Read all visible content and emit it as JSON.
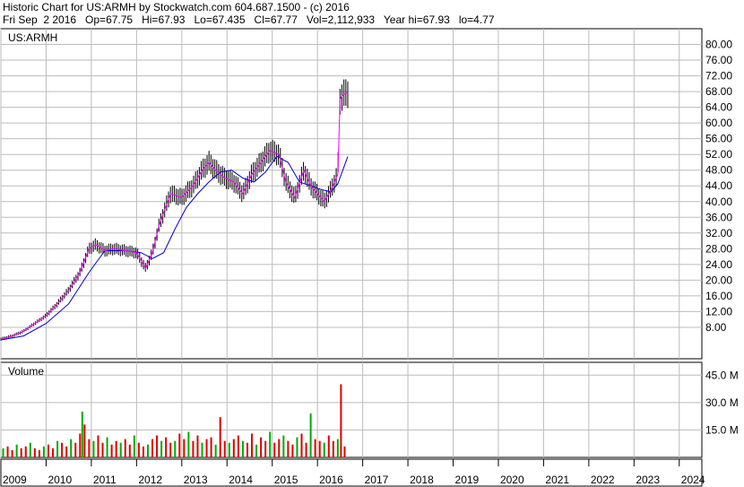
{
  "header": {
    "line1": "Historic Chart for US:ARMH by Stockwatch.com 604.687.1500 - (c) 2016",
    "line2": "Fri Sep  2 2016   Op=67.75   Hi=67.93   Lo=67.435   Cl=67.77   Vol=2,112,933   Year hi=67.93   lo=4.77"
  },
  "colors": {
    "price_line": "#ff00ff",
    "ma_line": "#0000cc",
    "candle": "#000000",
    "vol_up": "#00aa00",
    "vol_down": "#dd0000",
    "grid": "#bbbbbb"
  },
  "chart_data": [
    {
      "type": "line",
      "title": "US:ARMH",
      "ylim": [
        0,
        84
      ],
      "yticks": [
        "8.00",
        "12.00",
        "16.00",
        "20.00",
        "24.00",
        "28.00",
        "32.00",
        "36.00",
        "40.00",
        "44.00",
        "48.00",
        "52.00",
        "56.00",
        "60.00",
        "64.00",
        "68.00",
        "72.00",
        "76.00",
        "80.00"
      ],
      "xticks": [
        "2009",
        "2010",
        "2011",
        "2012",
        "2013",
        "2014",
        "2015",
        "2016",
        "2017",
        "2018",
        "2019",
        "2020",
        "2021",
        "2022",
        "2023",
        "2024"
      ],
      "series": [
        {
          "x": [
            2009.0,
            2009.25,
            2009.5,
            2009.75,
            2010.0,
            2010.25,
            2010.5,
            2010.75,
            2010.95,
            2011.1,
            2011.3,
            2011.5,
            2011.75,
            2012.0,
            2012.2,
            2012.35,
            2012.5,
            2012.75,
            2013.0,
            2013.25,
            2013.45,
            2013.6,
            2013.75,
            2013.95,
            2014.15,
            2014.35,
            2014.55,
            2014.75,
            2014.95,
            2015.15,
            2015.3,
            2015.5,
            2015.7,
            2015.85,
            2016.0,
            2016.15,
            2016.3,
            2016.45,
            2016.5,
            2016.55,
            2016.67
          ],
          "values": [
            5.0,
            5.8,
            7.0,
            9.0,
            11.0,
            14.0,
            17.5,
            22.0,
            28.0,
            29.0,
            27.5,
            28.0,
            27.5,
            27.0,
            23.0,
            27.0,
            34.0,
            42.0,
            41.0,
            44.0,
            48.0,
            50.0,
            48.0,
            46.0,
            45.0,
            42.0,
            47.0,
            50.0,
            53.0,
            52.0,
            45.0,
            41.0,
            48.0,
            44.0,
            42.0,
            40.0,
            43.0,
            47.0,
            66.0,
            67.0,
            67.77
          ]
        },
        {
          "x": [
            2009.0,
            2009.5,
            2010.0,
            2010.5,
            2010.95,
            2011.3,
            2011.75,
            2012.1,
            2012.35,
            2012.6,
            2012.85,
            2013.1,
            2013.35,
            2013.6,
            2013.85,
            2014.1,
            2014.35,
            2014.6,
            2014.85,
            2015.1,
            2015.35,
            2015.6,
            2015.85,
            2016.1,
            2016.3,
            2016.45,
            2016.67
          ],
          "values": [
            4.8,
            5.8,
            9.0,
            14.0,
            22.0,
            27.5,
            27.5,
            27.0,
            25.5,
            27.0,
            33.0,
            38.5,
            42.0,
            45.0,
            47.5,
            48.0,
            46.0,
            45.0,
            47.5,
            51.5,
            50.0,
            45.0,
            44.0,
            43.0,
            42.5,
            44.5,
            51.5
          ]
        }
      ]
    },
    {
      "type": "bar",
      "title": "Volume",
      "ylim": [
        0,
        52
      ],
      "yticks": [
        "15.0 M",
        "30.0 M",
        "45.0 M"
      ],
      "series": [
        {
          "x": [
            2009.05,
            2009.15,
            2009.25,
            2009.35,
            2009.45,
            2009.55,
            2009.65,
            2009.75,
            2009.85,
            2009.95,
            2010.05,
            2010.15,
            2010.25,
            2010.35,
            2010.45,
            2010.55,
            2010.65,
            2010.75,
            2010.8,
            2010.85,
            2010.95,
            2011.05,
            2011.15,
            2011.25,
            2011.35,
            2011.45,
            2011.55,
            2011.65,
            2011.75,
            2011.85,
            2011.95,
            2012.05,
            2012.15,
            2012.25,
            2012.35,
            2012.45,
            2012.55,
            2012.65,
            2012.75,
            2012.85,
            2012.95,
            2013.05,
            2013.15,
            2013.25,
            2013.35,
            2013.45,
            2013.55,
            2013.65,
            2013.75,
            2013.85,
            2013.95,
            2014.05,
            2014.15,
            2014.25,
            2014.35,
            2014.45,
            2014.55,
            2014.65,
            2014.75,
            2014.85,
            2014.95,
            2015.05,
            2015.15,
            2015.25,
            2015.35,
            2015.45,
            2015.55,
            2015.65,
            2015.75,
            2015.85,
            2015.95,
            2016.05,
            2016.15,
            2016.25,
            2016.35,
            2016.45,
            2016.52,
            2016.6
          ],
          "values": [
            5,
            6,
            4,
            7,
            5,
            6,
            8,
            5,
            4,
            6,
            7,
            5,
            9,
            8,
            6,
            10,
            8,
            13,
            25,
            18,
            10,
            9,
            12,
            8,
            11,
            7,
            9,
            8,
            10,
            7,
            12,
            8,
            6,
            7,
            10,
            12,
            9,
            11,
            8,
            9,
            13,
            10,
            14,
            9,
            12,
            8,
            10,
            11,
            7,
            22,
            9,
            8,
            10,
            12,
            9,
            8,
            13,
            7,
            11,
            9,
            14,
            8,
            10,
            12,
            9,
            7,
            11,
            13,
            8,
            24,
            10,
            9,
            8,
            12,
            9,
            10,
            40,
            6
          ]
        }
      ]
    }
  ]
}
